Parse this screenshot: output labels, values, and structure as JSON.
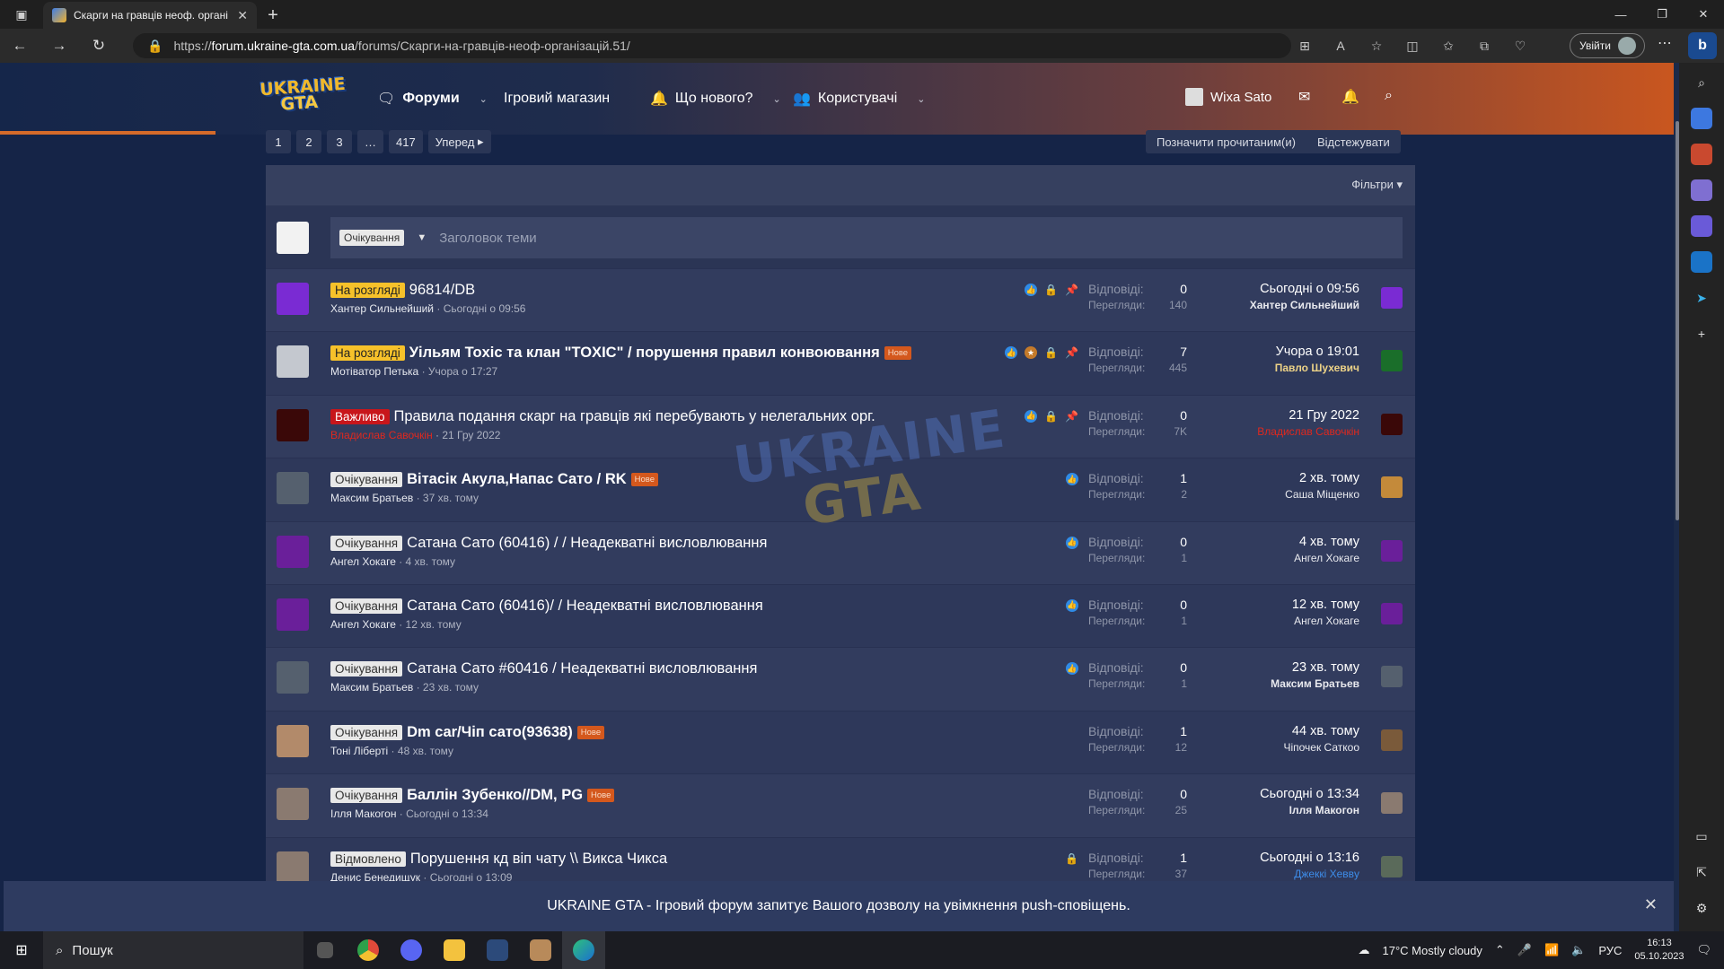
{
  "browser": {
    "tab_title": "Скарги на гравців неоф. органі",
    "url_prefix": "https://",
    "url_host": "forum.ukraine-gta.com.ua",
    "url_path": "/forums/Скарги-на-гравців-неоф-організацій.51/",
    "login_label": "Увійти"
  },
  "header": {
    "logo_line1": "UKRAINE",
    "logo_line2": "GTA",
    "nav": {
      "forums": "Форуми",
      "shop": "Ігровий магазин",
      "whats_new": "Що нового?",
      "users": "Користувачі"
    },
    "username": "Wixa Sato"
  },
  "pagination": {
    "pages": [
      "1",
      "2",
      "3",
      "…",
      "417"
    ],
    "next": "Уперед"
  },
  "actions": {
    "mark_read": "Позначити прочитаним(и)",
    "watch": "Відстежувати",
    "filters": "Фільтри"
  },
  "composer": {
    "prefix": "Очікування",
    "placeholder": "Заголовок теми"
  },
  "labels": {
    "replies": "Відповіді:",
    "views": "Перегляди:"
  },
  "threads": [
    {
      "prefix": "На розгляді",
      "prefix_style": "review",
      "title": "96814/DB",
      "bold": false,
      "new": false,
      "author": "Хантер Сильнейший",
      "author_style": "normal",
      "date": "Сьогодні о 09:56",
      "icons": [
        "like",
        "lock",
        "pin"
      ],
      "replies": "0",
      "views": "140",
      "last_time": "Сьогодні о 09:56",
      "last_user": "Хантер Сильнейший",
      "last_style": "bold",
      "avatar_color": "#7a2bd3",
      "last_avatar_color": "#7a2bd3"
    },
    {
      "prefix": "На розгляді",
      "prefix_style": "review",
      "title": "Уільям Toxic та клан \"TOXIC\" / порушення правил конвоювання",
      "bold": true,
      "new": true,
      "author": "Мотіватор Петька",
      "author_style": "normal",
      "date": "Учора о 17:27",
      "icons": [
        "like",
        "like2",
        "lock",
        "pin"
      ],
      "replies": "7",
      "views": "445",
      "last_time": "Учора о 19:01",
      "last_user": "Павло Шухевич",
      "last_style": "gold",
      "avatar_color": "#c4c8cf",
      "last_avatar_color": "#1a6e2a"
    },
    {
      "prefix": "Важливо",
      "prefix_style": "important",
      "title": "Правила подання скарг на гравців які перебувають у нелегальних орг.",
      "bold": false,
      "new": false,
      "author": "Владислав Савочкін",
      "author_style": "red",
      "date": "21 Гру 2022",
      "icons": [
        "like",
        "lock",
        "pin"
      ],
      "replies": "0",
      "views": "7K",
      "last_time": "21 Гру 2022",
      "last_user": "Владислав Савочкін",
      "last_style": "red",
      "avatar_color": "#3a0808",
      "last_avatar_color": "#3a0808"
    },
    {
      "prefix": "Очікування",
      "prefix_style": "wait",
      "title": "Вітасік Акула,Напас Сато / RK",
      "bold": true,
      "new": true,
      "author": "Максим Братьев",
      "author_style": "normal",
      "date": "37 хв. тому",
      "icons": [
        "like"
      ],
      "replies": "1",
      "views": "2",
      "last_time": "2 хв. тому",
      "last_user": "Саша Міщенко",
      "last_style": "normal",
      "avatar_color": "#55606e",
      "last_avatar_color": "#c48a3a"
    },
    {
      "prefix": "Очікування",
      "prefix_style": "wait",
      "title": "Сатана Сато (60416) / / Неадекватні висловлювання",
      "bold": false,
      "new": false,
      "author": "Ангел Хокаге",
      "author_style": "normal",
      "date": "4 хв. тому",
      "icons": [
        "like"
      ],
      "replies": "0",
      "views": "1",
      "last_time": "4 хв. тому",
      "last_user": "Ангел Хокаге",
      "last_style": "normal",
      "avatar_color": "#6a1f9a",
      "last_avatar_color": "#6a1f9a"
    },
    {
      "prefix": "Очікування",
      "prefix_style": "wait",
      "title": "Сатана Сато (60416)/ / Неадекватні висловлювання",
      "bold": false,
      "new": false,
      "author": "Ангел Хокаге",
      "author_style": "normal",
      "date": "12 хв. тому",
      "icons": [
        "like"
      ],
      "replies": "0",
      "views": "1",
      "last_time": "12 хв. тому",
      "last_user": "Ангел Хокаге",
      "last_style": "normal",
      "avatar_color": "#6a1f9a",
      "last_avatar_color": "#6a1f9a"
    },
    {
      "prefix": "Очікування",
      "prefix_style": "wait",
      "title": "Сатана Сато #60416 / Неадекватні висловлювання",
      "bold": false,
      "new": false,
      "author": "Максим Братьев",
      "author_style": "normal",
      "date": "23 хв. тому",
      "icons": [
        "like"
      ],
      "replies": "0",
      "views": "1",
      "last_time": "23 хв. тому",
      "last_user": "Максим Братьев",
      "last_style": "bold",
      "avatar_color": "#55606e",
      "last_avatar_color": "#55606e"
    },
    {
      "prefix": "Очікування",
      "prefix_style": "wait",
      "title": "Dm car/Чіп сато(93638)",
      "bold": true,
      "new": true,
      "author": "Тоні Ліберті",
      "author_style": "normal",
      "date": "48 хв. тому",
      "icons": [],
      "replies": "1",
      "views": "12",
      "last_time": "44 хв. тому",
      "last_user": "Чіпочек Саткоо",
      "last_style": "normal",
      "avatar_color": "#b28a6a",
      "last_avatar_color": "#7a5a3a"
    },
    {
      "prefix": "Очікування",
      "prefix_style": "wait",
      "title": "Баллін Зубенко//DM, PG",
      "bold": true,
      "new": true,
      "author": "Ілля Макогон",
      "author_style": "normal",
      "date": "Сьогодні о 13:34",
      "icons": [],
      "replies": "0",
      "views": "25",
      "last_time": "Сьогодні о 13:34",
      "last_user": "Ілля Макогон",
      "last_style": "bold",
      "avatar_color": "#8a7a70",
      "last_avatar_color": "#8a7a70"
    },
    {
      "prefix": "Відмовлено",
      "prefix_style": "rej",
      "title": "Порушення кд віп чату \\\\ Викса Чикса",
      "bold": false,
      "new": false,
      "author": "Денис Бенедищук",
      "author_style": "normal",
      "date": "Сьогодні о 13:09",
      "icons": [
        "lock"
      ],
      "replies": "1",
      "views": "37",
      "last_time": "Сьогодні о 13:16",
      "last_user": "Джеккі Хеввy",
      "last_style": "blue",
      "avatar_color": "#8a7a70",
      "last_avatar_color": "#5a6a5a"
    }
  ],
  "new_tag": "Нове",
  "watermark": {
    "line1": "UKRAINE",
    "line2": "GTA"
  },
  "push": {
    "message": "UKRAINE GTA - Ігровий форум запитує Вашого дозволу на увімкнення push-сповіщень."
  },
  "taskbar": {
    "search_label": "Пошук",
    "weather": "17°C  Mostly cloudy",
    "lang": "РУС",
    "time": "16:13",
    "date": "05.10.2023"
  }
}
